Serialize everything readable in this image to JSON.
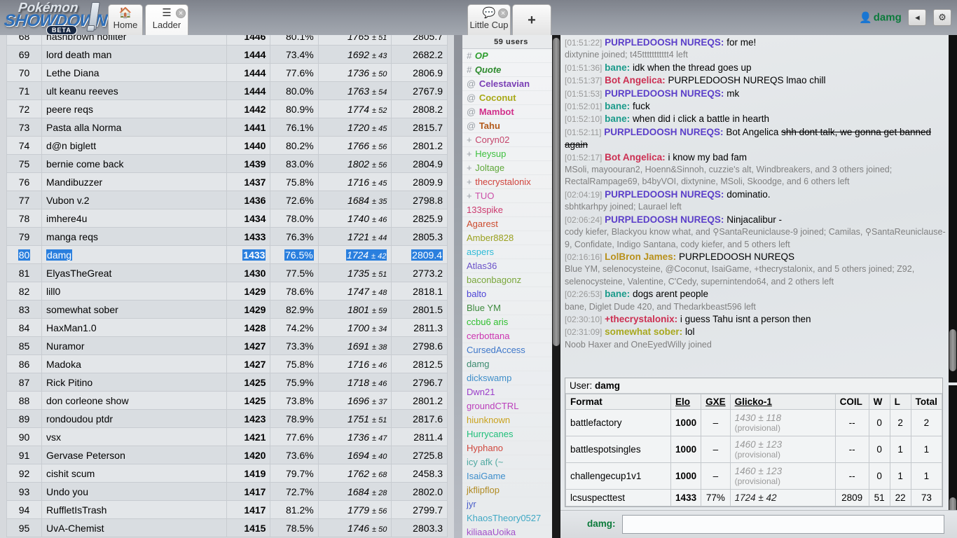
{
  "header": {
    "logo_line1": "Pokémon",
    "logo_line2": "SHOWDOWN",
    "logo_beta": "BETA",
    "tabs": [
      {
        "id": "home",
        "icon": "home-icon",
        "glyph": "🏠",
        "label": "Home",
        "closable": false,
        "active": false
      },
      {
        "id": "ladder",
        "icon": "list-icon",
        "glyph": "☰",
        "label": "Ladder",
        "closable": true,
        "active": true
      }
    ],
    "chat_tab": {
      "icon": "chat-bubble-icon",
      "glyph": "💬",
      "label": "Little Cup",
      "closable": true
    },
    "add_tab": {
      "icon": "plus-icon",
      "glyph": "+",
      "label": ""
    },
    "user": {
      "name": "damg",
      "avatar_icon": "person-icon",
      "avatar_glyph": "👤"
    },
    "buttons": [
      {
        "name": "volume-button",
        "icon": "speaker-icon",
        "glyph": "◂"
      },
      {
        "name": "settings-button",
        "icon": "gear-icon",
        "glyph": "⚙"
      }
    ]
  },
  "ladder": {
    "selected_rank": "80",
    "rows": [
      {
        "rank": "68",
        "name": "hashbrown nofilter",
        "elo": "1446",
        "gxe": "80.1%",
        "glicko": "1765",
        "dev": "51",
        "coil": "2805.7"
      },
      {
        "rank": "69",
        "name": "lord death man",
        "elo": "1444",
        "gxe": "73.4%",
        "glicko": "1692",
        "dev": "43",
        "coil": "2682.2"
      },
      {
        "rank": "70",
        "name": "Lethe Diana",
        "elo": "1444",
        "gxe": "77.6%",
        "glicko": "1736",
        "dev": "50",
        "coil": "2806.9"
      },
      {
        "rank": "71",
        "name": "ult keanu reeves",
        "elo": "1444",
        "gxe": "80.0%",
        "glicko": "1763",
        "dev": "54",
        "coil": "2767.9"
      },
      {
        "rank": "72",
        "name": "peere reqs",
        "elo": "1442",
        "gxe": "80.9%",
        "glicko": "1774",
        "dev": "52",
        "coil": "2808.2"
      },
      {
        "rank": "73",
        "name": "Pasta alla Norma",
        "elo": "1441",
        "gxe": "76.1%",
        "glicko": "1720",
        "dev": "45",
        "coil": "2815.7"
      },
      {
        "rank": "74",
        "name": "d@n biglett",
        "elo": "1440",
        "gxe": "80.2%",
        "glicko": "1766",
        "dev": "56",
        "coil": "2801.2"
      },
      {
        "rank": "75",
        "name": "bernie come back",
        "elo": "1439",
        "gxe": "83.0%",
        "glicko": "1802",
        "dev": "56",
        "coil": "2804.9"
      },
      {
        "rank": "76",
        "name": "Mandibuzzer",
        "elo": "1437",
        "gxe": "75.8%",
        "glicko": "1716",
        "dev": "45",
        "coil": "2809.9"
      },
      {
        "rank": "77",
        "name": "Vubon v.2",
        "elo": "1436",
        "gxe": "72.6%",
        "glicko": "1684",
        "dev": "35",
        "coil": "2798.8"
      },
      {
        "rank": "78",
        "name": "imhere4u",
        "elo": "1434",
        "gxe": "78.0%",
        "glicko": "1740",
        "dev": "46",
        "coil": "2825.9"
      },
      {
        "rank": "79",
        "name": "manga reqs",
        "elo": "1433",
        "gxe": "76.3%",
        "glicko": "1721",
        "dev": "44",
        "coil": "2805.3"
      },
      {
        "rank": "80",
        "name": "damg",
        "elo": "1433",
        "gxe": "76.5%",
        "glicko": "1724",
        "dev": "42",
        "coil": "2809.4"
      },
      {
        "rank": "81",
        "name": "ElyasTheGreat",
        "elo": "1430",
        "gxe": "77.5%",
        "glicko": "1735",
        "dev": "51",
        "coil": "2773.2"
      },
      {
        "rank": "82",
        "name": "lill0",
        "elo": "1429",
        "gxe": "78.6%",
        "glicko": "1747",
        "dev": "48",
        "coil": "2818.1"
      },
      {
        "rank": "83",
        "name": "somewhat sober",
        "elo": "1429",
        "gxe": "82.9%",
        "glicko": "1801",
        "dev": "59",
        "coil": "2801.5"
      },
      {
        "rank": "84",
        "name": "HaxMan1.0",
        "elo": "1428",
        "gxe": "74.2%",
        "glicko": "1700",
        "dev": "34",
        "coil": "2811.3"
      },
      {
        "rank": "85",
        "name": "Nuramor",
        "elo": "1427",
        "gxe": "73.3%",
        "glicko": "1691",
        "dev": "38",
        "coil": "2798.6"
      },
      {
        "rank": "86",
        "name": "Madoka",
        "elo": "1427",
        "gxe": "75.8%",
        "glicko": "1716",
        "dev": "46",
        "coil": "2812.5"
      },
      {
        "rank": "87",
        "name": "Rick Pitino",
        "elo": "1425",
        "gxe": "75.9%",
        "glicko": "1718",
        "dev": "46",
        "coil": "2796.7"
      },
      {
        "rank": "88",
        "name": "don corleone show",
        "elo": "1425",
        "gxe": "73.8%",
        "glicko": "1696",
        "dev": "37",
        "coil": "2801.2"
      },
      {
        "rank": "89",
        "name": "rondoudou ptdr",
        "elo": "1423",
        "gxe": "78.9%",
        "glicko": "1751",
        "dev": "51",
        "coil": "2817.6"
      },
      {
        "rank": "90",
        "name": "vsx",
        "elo": "1421",
        "gxe": "77.6%",
        "glicko": "1736",
        "dev": "47",
        "coil": "2811.4"
      },
      {
        "rank": "91",
        "name": "Gervase Peterson",
        "elo": "1420",
        "gxe": "73.6%",
        "glicko": "1694",
        "dev": "40",
        "coil": "2725.8"
      },
      {
        "rank": "92",
        "name": "cishit scum",
        "elo": "1419",
        "gxe": "79.7%",
        "glicko": "1762",
        "dev": "68",
        "coil": "2458.3"
      },
      {
        "rank": "93",
        "name": "Undo you",
        "elo": "1417",
        "gxe": "72.7%",
        "glicko": "1684",
        "dev": "28",
        "coil": "2802.0"
      },
      {
        "rank": "94",
        "name": "RuffletIsTrash",
        "elo": "1417",
        "gxe": "81.2%",
        "glicko": "1779",
        "dev": "56",
        "coil": "2799.7"
      },
      {
        "rank": "95",
        "name": "UvA-Chemist",
        "elo": "1415",
        "gxe": "78.5%",
        "glicko": "1746",
        "dev": "50",
        "coil": "2803.3"
      }
    ]
  },
  "userlist": {
    "count_label": "59 users",
    "users": [
      {
        "rank": "#",
        "name": "OP",
        "color": "#2e9e2e",
        "style": "italic"
      },
      {
        "rank": "#",
        "name": "Quote",
        "color": "#2e8b2e",
        "style": "italic"
      },
      {
        "rank": "@",
        "name": "Celestavian",
        "color": "#7a3fb5",
        "style": "normal"
      },
      {
        "rank": "@",
        "name": "Coconut",
        "color": "#a8a816",
        "style": "normal"
      },
      {
        "rank": "@",
        "name": "Mambot",
        "color": "#d12f8a",
        "style": "normal"
      },
      {
        "rank": "@",
        "name": "Tahu",
        "color": "#b35a1b",
        "style": "normal"
      },
      {
        "rank": "+",
        "name": "Coryn02",
        "color": "#c4456b",
        "style": "plain"
      },
      {
        "rank": "+",
        "name": "Heysup",
        "color": "#3ec03e",
        "style": "plain"
      },
      {
        "rank": "+",
        "name": "Joltage",
        "color": "#5fa83a",
        "style": "plain"
      },
      {
        "rank": "+",
        "name": "thecrystalonix",
        "color": "#d0433c",
        "style": "plain"
      },
      {
        "rank": "+",
        "name": "TUO",
        "color": "#cc4fa8",
        "style": "plain"
      },
      {
        "rank": "",
        "name": "133spike",
        "color": "#cc3a6e",
        "style": "plain"
      },
      {
        "rank": "",
        "name": "Agarest",
        "color": "#cc4b2e",
        "style": "plain"
      },
      {
        "rank": "",
        "name": "Amber8828",
        "color": "#9aa01e",
        "style": "plain"
      },
      {
        "rank": "",
        "name": "aspers",
        "color": "#2fbad6",
        "style": "plain"
      },
      {
        "rank": "",
        "name": "Atlas36",
        "color": "#6a52c9",
        "style": "plain"
      },
      {
        "rank": "",
        "name": "baconbagonz",
        "color": "#79a63a",
        "style": "plain"
      },
      {
        "rank": "",
        "name": "balto",
        "color": "#4b42d6",
        "style": "plain"
      },
      {
        "rank": "",
        "name": "Blue YM",
        "color": "#3e8a3e",
        "style": "plain"
      },
      {
        "rank": "",
        "name": "ccbu6 aris",
        "color": "#2fbf2f",
        "style": "plain"
      },
      {
        "rank": "",
        "name": "cerbottana",
        "color": "#cc34b0",
        "style": "plain"
      },
      {
        "rank": "",
        "name": "CursedAccess",
        "color": "#3e77c9",
        "style": "plain"
      },
      {
        "rank": "",
        "name": "damg",
        "color": "#3b8a6e",
        "style": "plain"
      },
      {
        "rank": "",
        "name": "dickswamp",
        "color": "#3f8ec9",
        "style": "plain"
      },
      {
        "rank": "",
        "name": "Dwn21",
        "color": "#9b3ec9",
        "style": "plain"
      },
      {
        "rank": "",
        "name": "groundCTRL",
        "color": "#bb3fbb",
        "style": "plain"
      },
      {
        "rank": "",
        "name": "hiunknown",
        "color": "#c9a21e",
        "style": "plain"
      },
      {
        "rank": "",
        "name": "Hurrycanes",
        "color": "#1fbf7a",
        "style": "plain"
      },
      {
        "rank": "",
        "name": "Hyphano",
        "color": "#d0463c",
        "style": "plain"
      },
      {
        "rank": "",
        "name": "icy afk (~",
        "color": "#4fa8a0",
        "style": "plain"
      },
      {
        "rank": "",
        "name": "IsaiGame",
        "color": "#3d8ecc",
        "style": "plain"
      },
      {
        "rank": "",
        "name": "jkflipflop",
        "color": "#b08a22",
        "style": "plain"
      },
      {
        "rank": "",
        "name": "jyr",
        "color": "#4a5ec9",
        "style": "plain"
      },
      {
        "rank": "",
        "name": "KhaosTheory0527",
        "color": "#3fa8c4",
        "style": "plain"
      },
      {
        "rank": "",
        "name": "kiliaaaUoika",
        "color": "#a24fc9",
        "style": "plain"
      }
    ]
  },
  "chat": {
    "messages": [
      {
        "type": "msg",
        "ts": "[01:51:22]",
        "name": "PURPLEDOOSH NUREQS:",
        "color": "#5b3fc9",
        "text": "for me!"
      },
      {
        "type": "join",
        "text": "dixtynine joined; t45ttttttttttt4 left"
      },
      {
        "type": "msg",
        "ts": "[01:51:36]",
        "name": "bane:",
        "color": "#1a9a8a",
        "text": "idk when the thread goes up"
      },
      {
        "type": "msg",
        "ts": "[01:51:37]",
        "name": "Bot Angelica:",
        "color": "#cc2f52",
        "text": "PURPLEDOOSH NUREQS lmao chill"
      },
      {
        "type": "msg",
        "ts": "[01:51:53]",
        "name": "PURPLEDOOSH NUREQS:",
        "color": "#5b3fc9",
        "text": "mk"
      },
      {
        "type": "msg",
        "ts": "[01:52:01]",
        "name": "bane:",
        "color": "#1a9a8a",
        "text": "fuck"
      },
      {
        "type": "msg",
        "ts": "[01:52:10]",
        "name": "bane:",
        "color": "#1a9a8a",
        "text": "when did i click a battle in hearth"
      },
      {
        "type": "msg_strike",
        "ts": "[01:52:11]",
        "name": "PURPLEDOOSH NUREQS:",
        "color": "#5b3fc9",
        "text": "Bot Angelica ",
        "strike": "shh dont talk, we gonna get banned again"
      },
      {
        "type": "msg",
        "ts": "[01:52:17]",
        "name": "Bot Angelica:",
        "color": "#cc2f52",
        "text": "i know my bad fam"
      },
      {
        "type": "join",
        "text": "MSoli, mayoouran2, Hoenn&Sinnoh, cuzzie's alt, Windbreakers, and 3 others joined; RectalRampage69, b4byVOI, dixtynine, MSoli, Skoodge, and 6 others left"
      },
      {
        "type": "msg",
        "ts": "[02:04:19]",
        "name": "PURPLEDOOSH NUREQS:",
        "color": "#5b3fc9",
        "text": "dominatio."
      },
      {
        "type": "join",
        "text": "sbhtkarhpy joined; Laurael left"
      },
      {
        "type": "msg",
        "ts": "[02:06:24]",
        "name": "PURPLEDOOSH NUREQS:",
        "color": "#5b3fc9",
        "text": "Ninjacalibur -"
      },
      {
        "type": "join",
        "text": "cody kiefer, Blackyou know what, and ⚲SantaReuniclause-9 joined; Camilas, ⚲SantaReuniclause-9, Confidate, Indigo Santana, cody kiefer, and 5 others left"
      },
      {
        "type": "msg",
        "ts": "[02:16:16]",
        "name": "LolBron James:",
        "color": "#b8901a",
        "text": "PURPLEDOOSH NUREQS"
      },
      {
        "type": "join",
        "text": "Blue YM, selenocysteine, @Coconut, IsaiGame, +thecrystalonix, and 5 others joined; Z92, selenocysteine, Valentine, C'Cedy, supernintendo64, and 2 others left"
      },
      {
        "type": "msg",
        "ts": "[02:26:53]",
        "name": "bane:",
        "color": "#1a9a8a",
        "text": "dogs arent people"
      },
      {
        "type": "join",
        "text": "bane, Diglet Dude 420, and Thedarkbeast596 left"
      },
      {
        "type": "msg",
        "ts": "[02:30:10]",
        "name": "+thecrystalonix:",
        "color": "#cc2f52",
        "text": "i guess Tahu isnt a person then"
      },
      {
        "type": "msg",
        "ts": "[02:31:09]",
        "name": "somewhat sober:",
        "color": "#a8a81e",
        "text": "lol"
      },
      {
        "type": "join",
        "text": "Noob Haxer and OneEyedWilly joined"
      }
    ]
  },
  "usercard": {
    "label": "User:",
    "username": "damg",
    "columns": [
      "Format",
      "Elo",
      "GXE",
      "Glicko-1",
      "COIL",
      "W",
      "L",
      "Total"
    ],
    "rows": [
      {
        "format": "battlefactory",
        "elo": "1000",
        "gxe": "–",
        "glicko": "1430 ± 118",
        "prov": "(provisional)",
        "coil": "--",
        "w": "0",
        "l": "2",
        "total": "2"
      },
      {
        "format": "battlespotsingles",
        "elo": "1000",
        "gxe": "–",
        "glicko": "1460 ± 123",
        "prov": "(provisional)",
        "coil": "--",
        "w": "0",
        "l": "1",
        "total": "1"
      },
      {
        "format": "challengecup1v1",
        "elo": "1000",
        "gxe": "–",
        "glicko": "1460 ± 123",
        "prov": "(provisional)",
        "coil": "--",
        "w": "0",
        "l": "1",
        "total": "1"
      },
      {
        "format": "lcsuspecttest",
        "elo": "1433",
        "gxe": "77%",
        "glicko": "1724 ± 42",
        "prov": "",
        "coil": "2809",
        "w": "51",
        "l": "22",
        "total": "73"
      }
    ]
  },
  "chatbar": {
    "who": "damg:",
    "value": "",
    "placeholder": ""
  }
}
